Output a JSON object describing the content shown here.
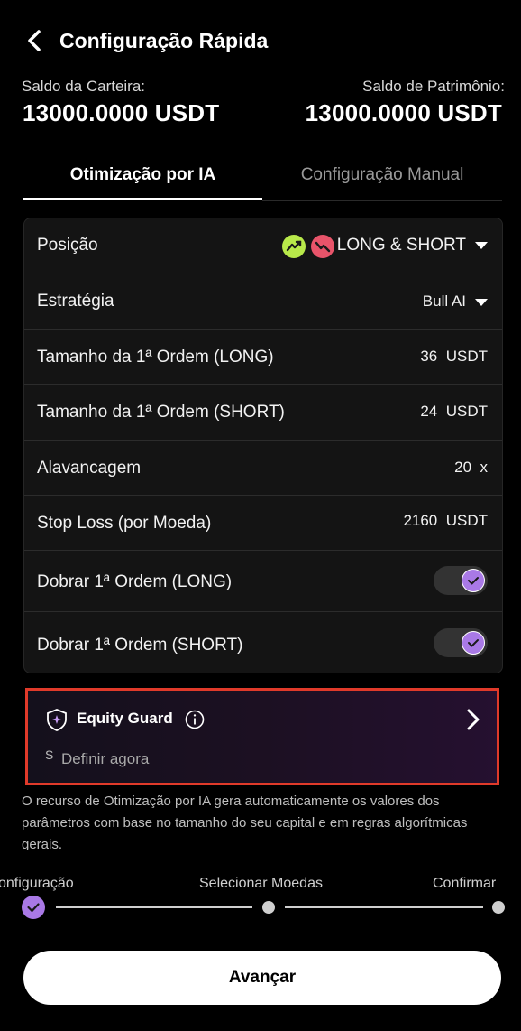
{
  "header": {
    "title": "Configuração Rápida"
  },
  "balances": {
    "wallet_label": "Saldo da Carteira:",
    "wallet_value": "13000.0000 USDT",
    "equity_label": "Saldo de Patrimônio:",
    "equity_value": "13000.0000 USDT"
  },
  "tabs": [
    {
      "label": "Otimização por IA",
      "active": true
    },
    {
      "label": "Configuração Manual",
      "active": false
    }
  ],
  "settings": {
    "position": {
      "label": "Posição",
      "value": "LONG & SHORT"
    },
    "strategy": {
      "label": "Estratégia",
      "value": "Bull AI"
    },
    "long_size": {
      "label": "Tamanho da 1ª Ordem (LONG)",
      "value": "36",
      "unit": "USDT"
    },
    "short_size": {
      "label": "Tamanho da 1ª Ordem (SHORT)",
      "value": "24",
      "unit": "USDT"
    },
    "leverage": {
      "label": "Alavancagem",
      "value": "20",
      "unit": "x"
    },
    "stop_loss": {
      "label": "Stop Loss (por Moeda)",
      "value": "2160",
      "unit": "USDT"
    },
    "double_long": {
      "label": "Dobrar 1ª Ordem (LONG)",
      "enabled": true
    },
    "double_short": {
      "label": "Dobrar 1ª Ordem (SHORT)",
      "enabled": true
    }
  },
  "equity_guard": {
    "title": "Equity Guard",
    "prefix": "S",
    "action": "Definir agora"
  },
  "description": "O recurso de Otimização por IA gera automaticamente os valores dos parâmetros com base no tamanho do seu capital e em regras algorítmicas gerais.",
  "steps": [
    {
      "label": "onfiguração",
      "state": "done"
    },
    {
      "label": "Selecionar Moedas",
      "state": "pending"
    },
    {
      "label": "Confirmar",
      "state": "pending"
    }
  ],
  "primary_button": "Avançar",
  "colors": {
    "accent": "#a979e6",
    "highlight_border": "#e03a2a",
    "long": "#b8e94a",
    "short": "#e8546a"
  }
}
